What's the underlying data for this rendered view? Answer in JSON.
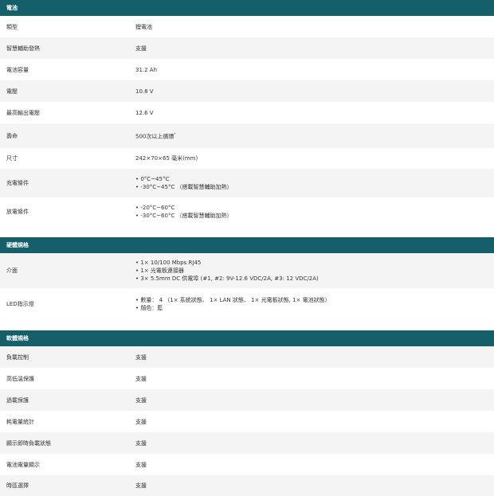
{
  "battery": {
    "title": "電池",
    "rows": [
      {
        "label": "類型",
        "value": [
          "鋰電池"
        ]
      },
      {
        "label": "智慧輔助發熱",
        "value": [
          "支援"
        ]
      },
      {
        "label": "電池容量",
        "value": [
          "31.2 Ah"
        ]
      },
      {
        "label": "電壓",
        "value": [
          "10.8 V"
        ]
      },
      {
        "label": "最高輸出電壓",
        "value": [
          "12.6 V"
        ]
      },
      {
        "label": "壽命",
        "value": [
          "500次以上循環"
        ],
        "sup": "*"
      },
      {
        "label": "尺寸",
        "value": [
          "242×70×65 毫米(mm)"
        ]
      },
      {
        "label": "充電條件",
        "value": [
          "• 0°C~45°C",
          "• -30°C~45°C （搭載智慧輔助加熱）"
        ]
      },
      {
        "label": "放電條件",
        "value": [
          "• -20°C~60°C",
          "• -30°C~60°C （搭載智慧輔助加熱）"
        ]
      }
    ]
  },
  "hardware": {
    "title": "硬體規格",
    "rows": [
      {
        "label": "介面",
        "value": [
          "• 1× 10/100 Mbps RJ45",
          "• 1× 光電板連接器",
          "• 3× 5.5mm DC 供電埠 (#1, #2: 9V-12.6 VDC/2A, #3: 12 VDC/2A)"
        ]
      },
      {
        "label": "LED指示燈",
        "value": [
          "• 數量： 4 （1× 系統狀態、 1× LAN 狀態、 1× 光電板狀態, 1× 電池狀態）",
          "• 顏色：藍"
        ]
      }
    ]
  },
  "software": {
    "title": "軟體規格",
    "rows": [
      {
        "label": "負載控制",
        "value": [
          "支援"
        ]
      },
      {
        "label": "高低溫保護",
        "value": [
          "支援"
        ]
      },
      {
        "label": "過載保護",
        "value": [
          "支援"
        ]
      },
      {
        "label": "耗電量統計",
        "value": [
          "支援"
        ]
      },
      {
        "label": "顯示即時負載狀態",
        "value": [
          "支援"
        ]
      },
      {
        "label": "電池電量顯示",
        "value": [
          "支援"
        ]
      },
      {
        "label": "時區選擇",
        "value": [
          "支援"
        ]
      }
    ]
  }
}
